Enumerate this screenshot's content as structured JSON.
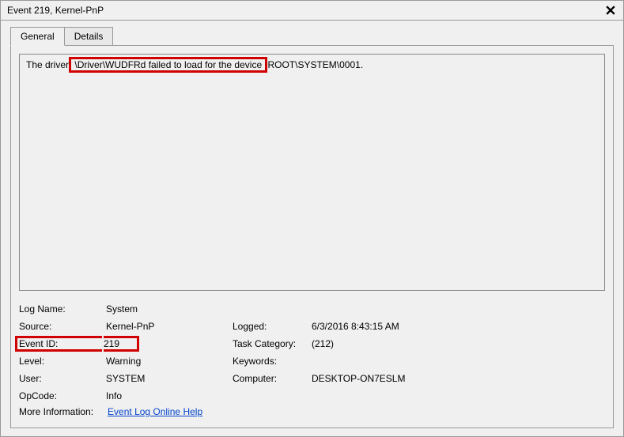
{
  "window": {
    "title": "Event 219, Kernel-PnP",
    "close_label": "Close"
  },
  "tabs": {
    "general": "General",
    "details": "Details"
  },
  "description": {
    "prefix": "The driver",
    "highlighted": " \\Driver\\WUDFRd failed to load for the device ",
    "suffix": "ROOT\\SYSTEM\\0001."
  },
  "fields": {
    "logname_label": "Log Name:",
    "logname_value": "System",
    "source_label": "Source:",
    "source_value": "Kernel-PnP",
    "logged_label": "Logged:",
    "logged_value": "6/3/2016 8:43:15 AM",
    "eventid_label": "Event ID:",
    "eventid_value": "219",
    "taskcat_label": "Task Category:",
    "taskcat_value": "(212)",
    "level_label": "Level:",
    "level_value": "Warning",
    "keywords_label": "Keywords:",
    "keywords_value": "",
    "user_label": "User:",
    "user_value": "SYSTEM",
    "computer_label": "Computer:",
    "computer_value": "DESKTOP-ON7ESLM",
    "opcode_label": "OpCode:",
    "opcode_value": "Info",
    "moreinfo_label": "More Information:",
    "moreinfo_link": "Event Log Online Help"
  }
}
